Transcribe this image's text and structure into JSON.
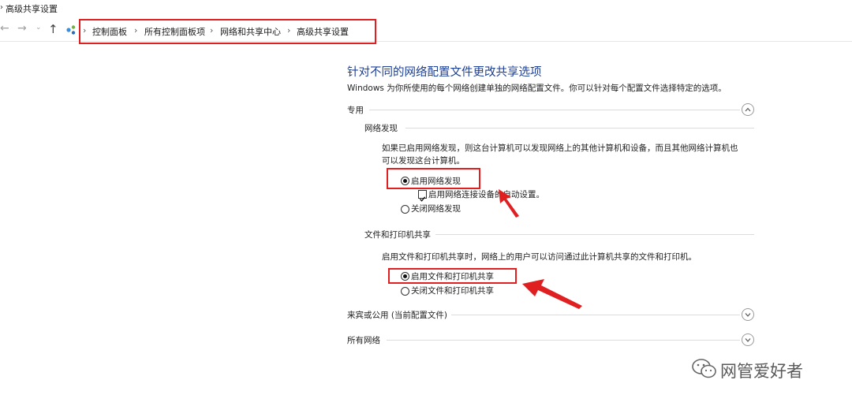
{
  "window": {
    "title": "高级共享设置"
  },
  "nav": {
    "back_icon": "back-arrow-icon",
    "forward_icon": "forward-arrow-icon",
    "recent_icon": "chevron-down-icon",
    "up_icon": "up-arrow-icon",
    "breadcrumbs": [
      "控制面板",
      "所有控制面板项",
      "网络和共享中心",
      "高级共享设置"
    ]
  },
  "main": {
    "heading": "针对不同的网络配置文件更改共享选项",
    "description": "Windows 为你所使用的每个网络创建单独的网络配置文件。你可以针对每个配置文件选择特定的选项。",
    "private": {
      "label": "专用",
      "expanded": true,
      "network_discovery": {
        "title": "网络发现",
        "text_line1": "如果已启用网络发现，则这台计算机可以发现网络上的其他计算机和设备，而且其他网络计算机也",
        "text_line2": "可以发现这台计算机。",
        "option_on": "启用网络发现",
        "auto_setup": "启用网络连接设备的自动设置。",
        "option_off": "关闭网络发现",
        "selected": "on",
        "auto_setup_checked": true
      },
      "file_printer_sharing": {
        "title": "文件和打印机共享",
        "text": "启用文件和打印机共享时，网络上的用户可以访问通过此计算机共享的文件和打印机。",
        "option_on": "启用文件和打印机共享",
        "option_off": "关闭文件和打印机共享",
        "selected": "on"
      }
    },
    "guest_public": {
      "label": "来宾或公用 (当前配置文件)",
      "expanded": false
    },
    "all_networks": {
      "label": "所有网络",
      "expanded": false
    }
  },
  "annotations": {
    "highlight_color": "#e02020"
  },
  "watermark": {
    "text": "网管爱好者",
    "icon": "wechat-logo-icon"
  }
}
